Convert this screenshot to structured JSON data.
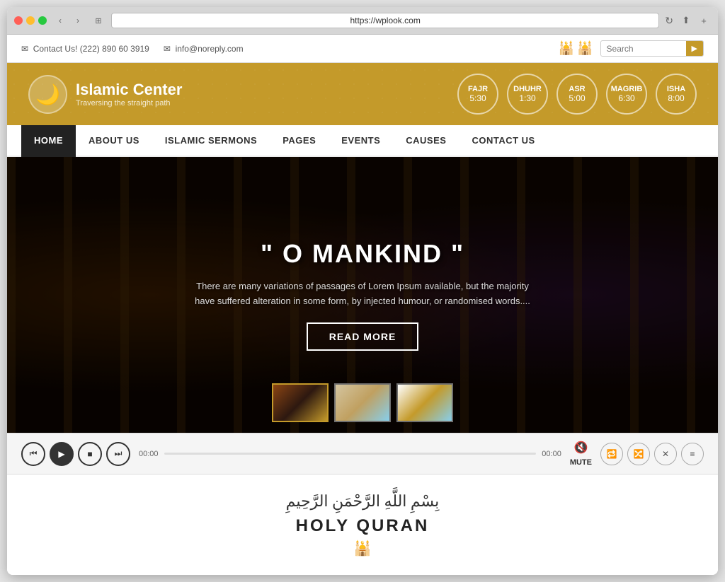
{
  "browser": {
    "address": "https://wplook.com",
    "reload_title": "Reload"
  },
  "topbar": {
    "contact_icon": "✉",
    "contact_text": "Contact Us! (222) 890 60 3919",
    "email_icon": "✉",
    "email_text": "info@noreply.com",
    "search_placeholder": "Search",
    "search_icon": "▶"
  },
  "header": {
    "logo_icon": "🌙",
    "site_name": "Islamic Center",
    "tagline": "Traversing the straight path",
    "prayer_times": [
      {
        "name": "FAJR",
        "time": "5:30"
      },
      {
        "name": "DHUHR",
        "time": "1:30"
      },
      {
        "name": "ASR",
        "time": "5:00"
      },
      {
        "name": "MAGRIB",
        "time": "6:30"
      },
      {
        "name": "ISHA",
        "time": "8:00"
      }
    ]
  },
  "nav": {
    "items": [
      {
        "label": "HOME",
        "active": true
      },
      {
        "label": "ABOUT US",
        "active": false
      },
      {
        "label": "ISLAMIC SERMONS",
        "active": false
      },
      {
        "label": "PAGES",
        "active": false
      },
      {
        "label": "EVENTS",
        "active": false
      },
      {
        "label": "CAUSES",
        "active": false
      },
      {
        "label": "CONTACT US",
        "active": false
      }
    ]
  },
  "hero": {
    "quote": "\" O MANKIND \"",
    "description": "There are many variations of passages of Lorem Ipsum available, but the majority have suffered alteration in some form, by injected humour, or randomised words....",
    "read_more": "READ MORE"
  },
  "media_player": {
    "time_start": "00:00",
    "time_end": "00:00",
    "mute_label": "MUTE"
  },
  "quran": {
    "arabic_text": "بِسْمِ اللَّهِ الرَّحْمَنِ الرَّحِيمِ",
    "title": "HOLY QURAN",
    "icon": "🕌"
  }
}
